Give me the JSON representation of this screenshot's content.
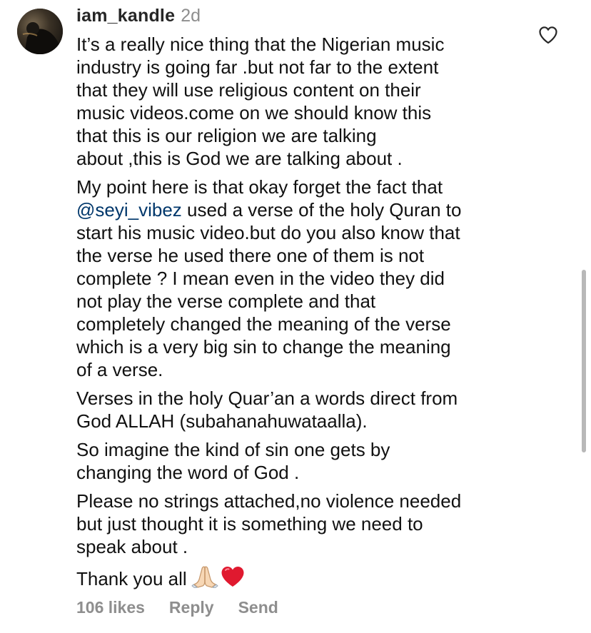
{
  "comment": {
    "username": "iam_kandle",
    "timestamp": "2d",
    "paragraphs": {
      "p1": "It’s a really nice thing that the Nigerian music\nindustry is going far .but not far to the extent\nthat they will use religious content on their\nmusic videos.come on we should know this\nthat this is our religion we are talking\nabout ,this is God we are talking about .",
      "p2_start": "My point here is that okay forget the fact that\n",
      "p2_mention": "@seyi_vibez",
      "p2_end": "  used a verse of the holy Quran to\nstart his music video.but do you also know that\nthe verse he used there one of them is not\ncomplete ? I mean even in the video they did\nnot play the verse complete and that\ncompletely changed the meaning of the verse\nwhich is a very big sin to change the meaning\nof a verse.",
      "p3": "Verses in the holy Quar’an a words direct from\nGod ALLAH (subahanahuwataalla).",
      "p4": "So imagine the kind of sin one gets by\nchanging the word of God .",
      "p5": "Please no strings attached,no violence needed\nbut just thought it is something we need to\nspeak about .",
      "p6": "Thank you all"
    },
    "icons": {
      "avatar": "avatar-image",
      "like": "heart-outline-icon",
      "emoji1": "folded-hands-emoji",
      "emoji2": "red-heart-emoji"
    },
    "actions": {
      "likes": "106 likes",
      "reply": "Reply",
      "send": "Send"
    }
  },
  "colors": {
    "text": "#111111",
    "username": "#262626",
    "muted": "#8e8e8e",
    "mention": "#00376b",
    "heart": "#e0192f"
  }
}
